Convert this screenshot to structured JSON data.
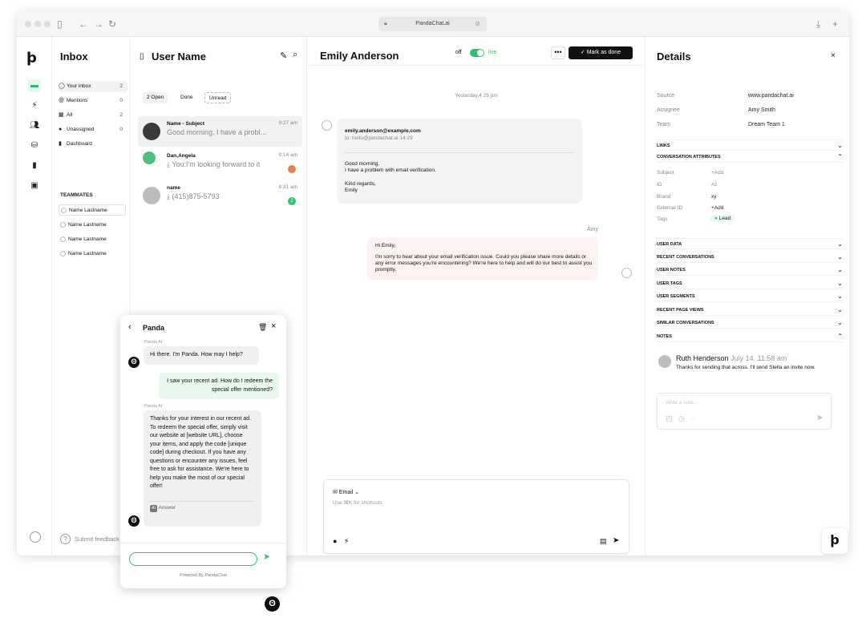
{
  "browser": {
    "url": "PandaChat.ai",
    "back": "←",
    "forward": "→",
    "reload": "↻",
    "download": "⤓",
    "new_tab": "+"
  },
  "brand": {
    "logo_glyph": "ϸ",
    "accent": "#34c06b"
  },
  "inbox": {
    "title": "Inbox",
    "items": [
      {
        "label": "Your inbox",
        "count": "2",
        "icon": "avatar-icon"
      },
      {
        "label": "Mentions",
        "count": "0",
        "icon": "at-icon"
      },
      {
        "label": "All",
        "count": "2",
        "icon": "grid-icon"
      },
      {
        "label": "Unassigned",
        "count": "0",
        "icon": "user-icon"
      },
      {
        "label": "Dashboard",
        "count": "",
        "icon": "bar-chart-icon"
      }
    ],
    "teammates_title": "TEAMMATES",
    "teammates": [
      "Name Lastname",
      "Name Lastname",
      "Name Lastname",
      "Name Lastname"
    ],
    "submit_feedback": "Submit feedback"
  },
  "conversations": {
    "title": "User Name",
    "filters": {
      "open": "2 Open",
      "done": "Done",
      "unread": "Unread"
    },
    "items": [
      {
        "name": "Name - Subject",
        "preview": "Good morning, I have a probl...",
        "time": "9:27 am",
        "badge": ""
      },
      {
        "name": "Dan,Angela",
        "preview": "You:I'm looking forward to it",
        "time": "9:14 am",
        "badge": ""
      },
      {
        "name": "name",
        "preview": "(415)875-5793",
        "time": "8:31 am",
        "badge": "2"
      }
    ]
  },
  "chat": {
    "contact": "Emily Anderson",
    "live_off": "off",
    "live_on": "live",
    "more": "•••",
    "mark_done": "Mark as done",
    "timestamp": "Yesterday,4:29 pm",
    "incoming": {
      "from": "emily.anderson@example.com",
      "to": "to: hello@pandachat.ai 14:29",
      "line1": "Good morning,",
      "line2": "I have a problem with email verification.",
      "line3": "Kind regards,",
      "line4": "Emily"
    },
    "agent_name": "Amy",
    "outgoing": {
      "greeting": "Hi Emily,",
      "body": "I'm sorry to hear about your email verification issue. Could you please share more details or any error messages you're encountering? We're here to help and will do our best to assist you promptly."
    },
    "composer": {
      "channel": "Email",
      "placeholder": "Use ⌘K for shortcuts"
    }
  },
  "details": {
    "title": "Details",
    "rows": [
      {
        "key": "Source",
        "value": "www.pandachat.ai"
      },
      {
        "key": "Assignee",
        "value": "Amy Smith"
      },
      {
        "key": "Team",
        "value": "Dream Team 1"
      }
    ],
    "links": "LINKS",
    "conv_attrs": "CONVERSATION ATTRIBUTES",
    "attrs": [
      {
        "key": "Subject",
        "value": "+Add"
      },
      {
        "key": "ID",
        "value": "#2"
      },
      {
        "key": "Brand",
        "value": "xy"
      },
      {
        "key": "External ID",
        "value": "+Add"
      },
      {
        "key": "Tags",
        "value": "Lead"
      }
    ],
    "sections": [
      "USER DATA",
      "RECENT CONVERSATIONS",
      "USER NOTES",
      "USER TAGS",
      "USER SEGMENTS",
      "RECENT PAGE VIEWS",
      "SIMILAR CONVERSATIONS"
    ],
    "notes_title": "NOTES",
    "note": {
      "author": "Ruth Henderson",
      "date": "July 14, 11:58 am",
      "text": "Thanks for sending that across. I'll send Stella an invite now."
    },
    "note_placeholder": "Write a note..."
  },
  "widget": {
    "title": "Panda",
    "bot_label": "Panda AI",
    "msg1": "Hi there. I'm Panda. How may I help?",
    "user_msg": "I saw your recent ad. How do I redeem the special offer mentioned?",
    "bot_label2": "Panda AI",
    "msg2": "Thanks for your interest in our recent ad. To redeem the special offer, simply visit our website at [website URL], choose your items, and apply the code [unique code] during checkout. If you have any questions or encounter any issues, feel free to ask for assistance. We're here to help you make the most of our special offer!",
    "answer_label": "Answer",
    "powered_by": "Powered By PandaChat"
  }
}
